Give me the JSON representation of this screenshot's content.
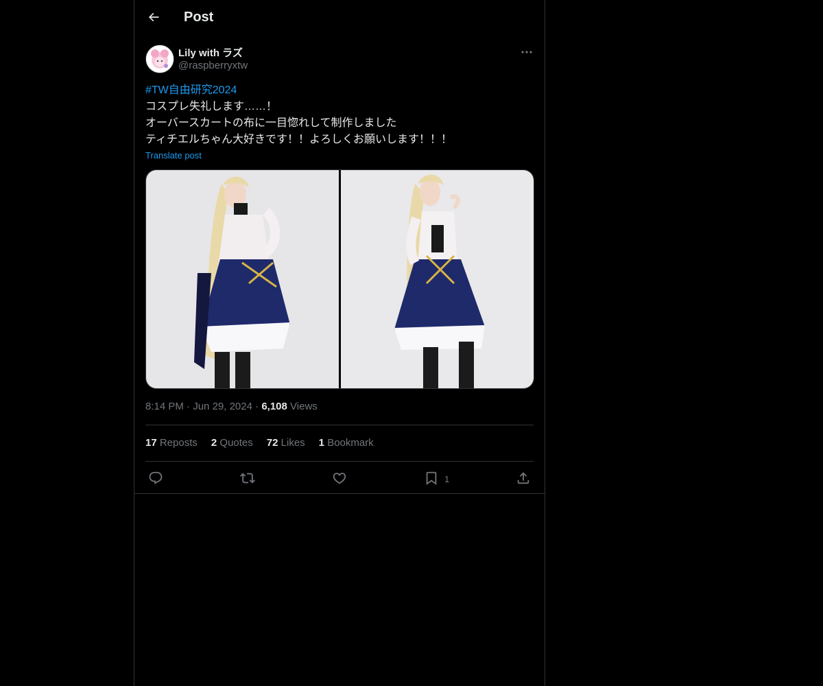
{
  "header": {
    "title": "Post"
  },
  "author": {
    "name": "Lily with ラズ",
    "handle": "@raspberryxtw"
  },
  "post": {
    "hashtag": "#TW自由研究2024",
    "lines": [
      "コスプレ失礼します……！",
      "オーバースカートの布に一目惚れして制作しました",
      "ティチエルちゃん大好きです！！よろしくお願いします！！！"
    ],
    "translate_label": "Translate post"
  },
  "meta": {
    "time": "8:14 PM",
    "date": "Jun 29, 2024",
    "views_count": "6,108",
    "views_label": "Views",
    "separator": "·"
  },
  "stats": {
    "reposts": {
      "count": "17",
      "label": "Reposts"
    },
    "quotes": {
      "count": "2",
      "label": "Quotes"
    },
    "likes": {
      "count": "72",
      "label": "Likes"
    },
    "bookmarks": {
      "count": "1",
      "label": "Bookmark"
    }
  },
  "actions": {
    "bookmark_count": "1"
  },
  "icons": [
    "back-arrow-icon",
    "more-icon",
    "reply-icon",
    "repost-icon",
    "like-icon",
    "bookmark-icon",
    "share-icon"
  ],
  "colors": {
    "background": "#000000",
    "text": "#e7e9ea",
    "secondary": "#71767b",
    "link": "#1d9bf0",
    "border": "#2f3336"
  }
}
